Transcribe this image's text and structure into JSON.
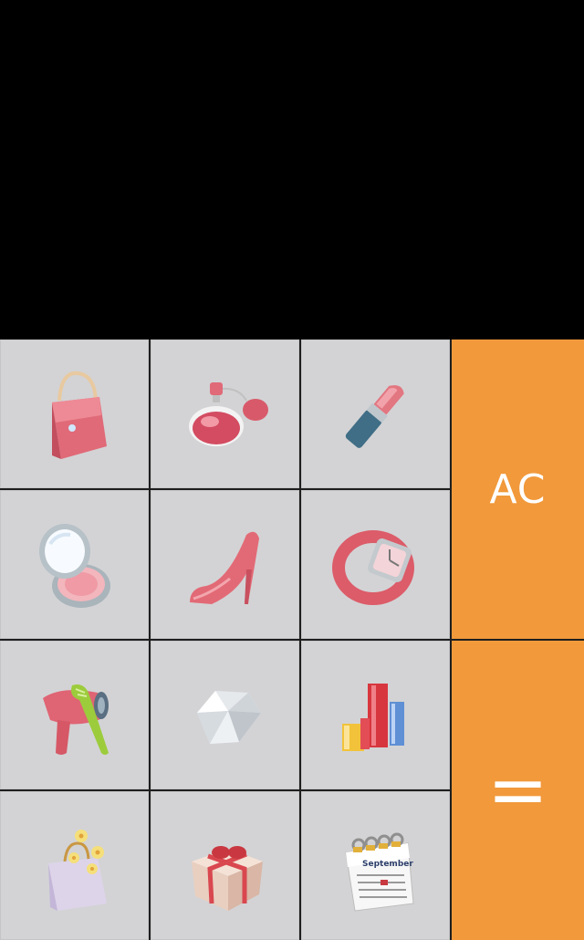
{
  "display": {
    "value": ""
  },
  "keys": {
    "ac_label": "AC",
    "equals_label": "="
  },
  "icons": [
    [
      "handbag-icon",
      "perfume-icon",
      "lipstick-icon"
    ],
    [
      "compact-mirror-icon",
      "high-heel-icon",
      "wristwatch-icon"
    ],
    [
      "hair-dryer-icon",
      "diamond-icon",
      "cosmetic-bottles-icon"
    ],
    [
      "shopping-bag-icon",
      "gift-box-icon",
      "calendar-icon"
    ]
  ],
  "calendar_month": "September",
  "colors": {
    "accent": "#f1993b",
    "key_bg": "#d3d3d5",
    "display_bg": "#000000"
  }
}
